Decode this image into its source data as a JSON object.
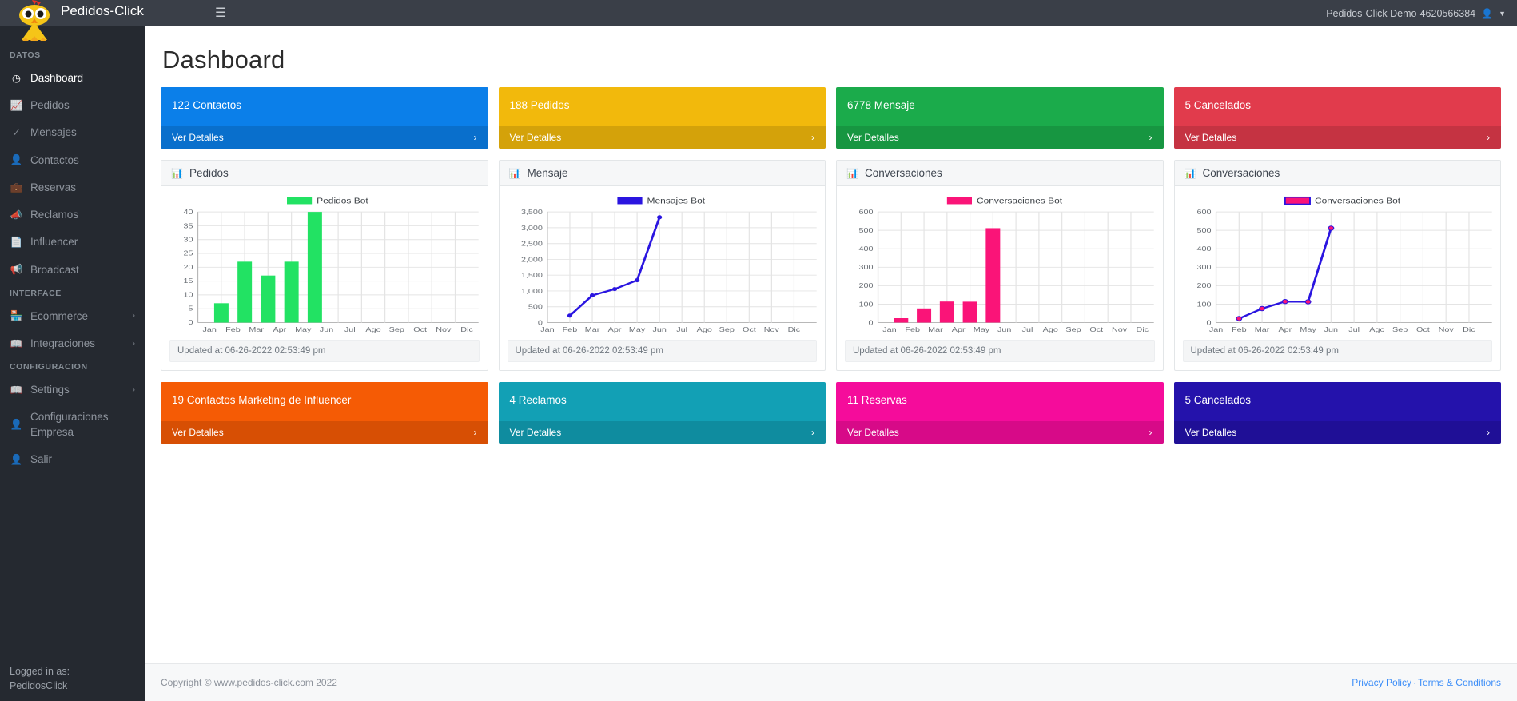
{
  "brand": {
    "title": "Pedidos-Click",
    "logo_icon": "chicken-logo"
  },
  "topbar": {
    "menu_icon": "hamburger-icon",
    "user_label": "Pedidos-Click Demo-4620566384",
    "user_icon": "user-icon",
    "caret_icon": "chevron-down-icon"
  },
  "sidebar": {
    "sections": [
      {
        "label": "DATOS",
        "items": [
          {
            "label": "Dashboard",
            "icon": "dashboard-icon",
            "active": true,
            "caret": ""
          },
          {
            "label": "Pedidos",
            "icon": "chart-line-icon",
            "active": false,
            "caret": ""
          },
          {
            "label": "Mensajes",
            "icon": "double-check-icon",
            "active": false,
            "caret": ""
          },
          {
            "label": "Contactos",
            "icon": "user-check-icon",
            "active": false,
            "caret": ""
          },
          {
            "label": "Reservas",
            "icon": "briefcase-clock-icon",
            "active": false,
            "caret": ""
          },
          {
            "label": "Reclamos",
            "icon": "megaphone-icon",
            "active": false,
            "caret": ""
          },
          {
            "label": "Influencer",
            "icon": "id-card-icon",
            "active": false,
            "caret": ""
          },
          {
            "label": "Broadcast",
            "icon": "broadcast-icon",
            "active": false,
            "caret": ""
          }
        ]
      },
      {
        "label": "INTERFACE",
        "items": [
          {
            "label": "Ecommerce",
            "icon": "store-icon",
            "active": false,
            "caret": "›"
          },
          {
            "label": "Integraciones",
            "icon": "book-icon",
            "active": false,
            "caret": "›"
          }
        ]
      },
      {
        "label": "CONFIGURACION",
        "items": [
          {
            "label": "Settings",
            "icon": "book-icon",
            "active": false,
            "caret": "›"
          },
          {
            "label": "Configuraciones Empresa",
            "icon": "user-check-icon",
            "active": false,
            "caret": ""
          },
          {
            "label": "Salir",
            "icon": "user-check-icon",
            "active": false,
            "caret": ""
          }
        ]
      }
    ],
    "footer": {
      "line1": "Logged in as:",
      "line2": "PedidosClick"
    }
  },
  "page": {
    "title": "Dashboard"
  },
  "stat_cards_top": [
    {
      "title": "122 Contactos",
      "link": "Ver Detalles",
      "color": "#0b7fe9",
      "arrow": "›"
    },
    {
      "title": "188 Pedidos",
      "link": "Ver Detalles",
      "color": "#f2b90c",
      "arrow": "›"
    },
    {
      "title": "6778 Mensaje",
      "link": "Ver Detalles",
      "color": "#1bab4b",
      "arrow": "›"
    },
    {
      "title": "5 Cancelados",
      "link": "Ver Detalles",
      "color": "#e13b4c",
      "arrow": "›"
    }
  ],
  "stat_cards_bottom": [
    {
      "title": "19 Contactos Marketing de Influencer",
      "link": "Ver Detalles",
      "color": "#f55b05",
      "arrow": "›"
    },
    {
      "title": "4 Reclamos",
      "link": "Ver Detalles",
      "color": "#12a0b5",
      "arrow": "›"
    },
    {
      "title": "11 Reservas",
      "link": "Ver Detalles",
      "color": "#f50c9b",
      "arrow": "›"
    },
    {
      "title": "5 Cancelados",
      "link": "Ver Detalles",
      "color": "#2412ab",
      "arrow": "›"
    }
  ],
  "panels": [
    {
      "title": "Pedidos",
      "icon": "bar-chart-icon",
      "updated": "Updated at 06-26-2022 02:53:49 pm"
    },
    {
      "title": "Mensaje",
      "icon": "bar-chart-icon",
      "updated": "Updated at 06-26-2022 02:53:49 pm"
    },
    {
      "title": "Conversaciones",
      "icon": "bar-chart-icon",
      "updated": "Updated at 06-26-2022 02:53:49 pm"
    },
    {
      "title": "Conversaciones",
      "icon": "bar-chart-icon",
      "updated": "Updated at 06-26-2022 02:53:49 pm"
    }
  ],
  "chart_data": [
    {
      "type": "bar",
      "title": "Pedidos",
      "legend": [
        "Pedidos Bot"
      ],
      "legend_position": "top-center",
      "categories": [
        "Jan",
        "Feb",
        "Mar",
        "Apr",
        "May",
        "Jun",
        "Jul",
        "Ago",
        "Sep",
        "Oct",
        "Nov",
        "Dic"
      ],
      "values": [
        0,
        7,
        22,
        17,
        22,
        40,
        0,
        0,
        0,
        0,
        0,
        0
      ],
      "yticks": [
        0,
        5,
        10,
        15,
        20,
        25,
        30,
        35,
        40
      ],
      "ytick_labels": [
        "0",
        "5",
        "10",
        "15",
        "20",
        "25",
        "30",
        "35",
        "40"
      ],
      "ylim": [
        0,
        40
      ],
      "xlabel": "",
      "ylabel": "",
      "color": "#22e263",
      "grid": true
    },
    {
      "type": "line",
      "title": "Mensaje",
      "legend": [
        "Mensajes Bot"
      ],
      "legend_position": "top-center",
      "categories": [
        "Jan",
        "Feb",
        "Mar",
        "Apr",
        "May",
        "Jun",
        "Jul",
        "Ago",
        "Sep",
        "Oct",
        "Nov",
        "Dic"
      ],
      "values": [
        null,
        220,
        860,
        1060,
        1340,
        3330,
        null,
        null,
        null,
        null,
        null,
        null
      ],
      "yticks": [
        0,
        500,
        1000,
        1500,
        2000,
        2500,
        3000,
        3500
      ],
      "ytick_labels": [
        "0",
        "500",
        "1,000",
        "1,500",
        "2,000",
        "2,500",
        "3,000",
        "3,500"
      ],
      "ylim": [
        0,
        3500
      ],
      "xlabel": "",
      "ylabel": "",
      "color": "#2a15e0",
      "grid": true
    },
    {
      "type": "bar",
      "title": "Conversaciones",
      "legend": [
        "Conversaciones Bot"
      ],
      "legend_position": "top-center",
      "categories": [
        "Jan",
        "Feb",
        "Mar",
        "Apr",
        "May",
        "Jun",
        "Jul",
        "Ago",
        "Sep",
        "Oct",
        "Nov",
        "Dic"
      ],
      "values": [
        0,
        24,
        77,
        114,
        113,
        512,
        0,
        0,
        0,
        0,
        0,
        0
      ],
      "yticks": [
        0,
        100,
        200,
        300,
        400,
        500,
        600
      ],
      "ytick_labels": [
        "0",
        "100",
        "200",
        "300",
        "400",
        "500",
        "600"
      ],
      "ylim": [
        0,
        600
      ],
      "xlabel": "",
      "ylabel": "",
      "color": "#fa1478",
      "grid": true
    },
    {
      "type": "line",
      "title": "Conversaciones",
      "legend": [
        "Conversaciones Bot"
      ],
      "legend_position": "top-center",
      "categories": [
        "Jan",
        "Feb",
        "Mar",
        "Apr",
        "May",
        "Jun",
        "Jul",
        "Ago",
        "Sep",
        "Oct",
        "Nov",
        "Dic"
      ],
      "values": [
        null,
        22,
        76,
        114,
        113,
        512,
        null,
        null,
        null,
        null,
        null,
        null
      ],
      "yticks": [
        0,
        100,
        200,
        300,
        400,
        500,
        600
      ],
      "ytick_labels": [
        "0",
        "100",
        "200",
        "300",
        "400",
        "500",
        "600"
      ],
      "ylim": [
        0,
        600
      ],
      "xlabel": "",
      "ylabel": "",
      "color": "#2a15e0",
      "marker_color": "#fa1478",
      "grid": true
    }
  ],
  "footer": {
    "copyright": "Copyright © www.pedidos-click.com 2022",
    "privacy": "Privacy Policy",
    "separator": "·",
    "terms": "Terms & Conditions"
  }
}
